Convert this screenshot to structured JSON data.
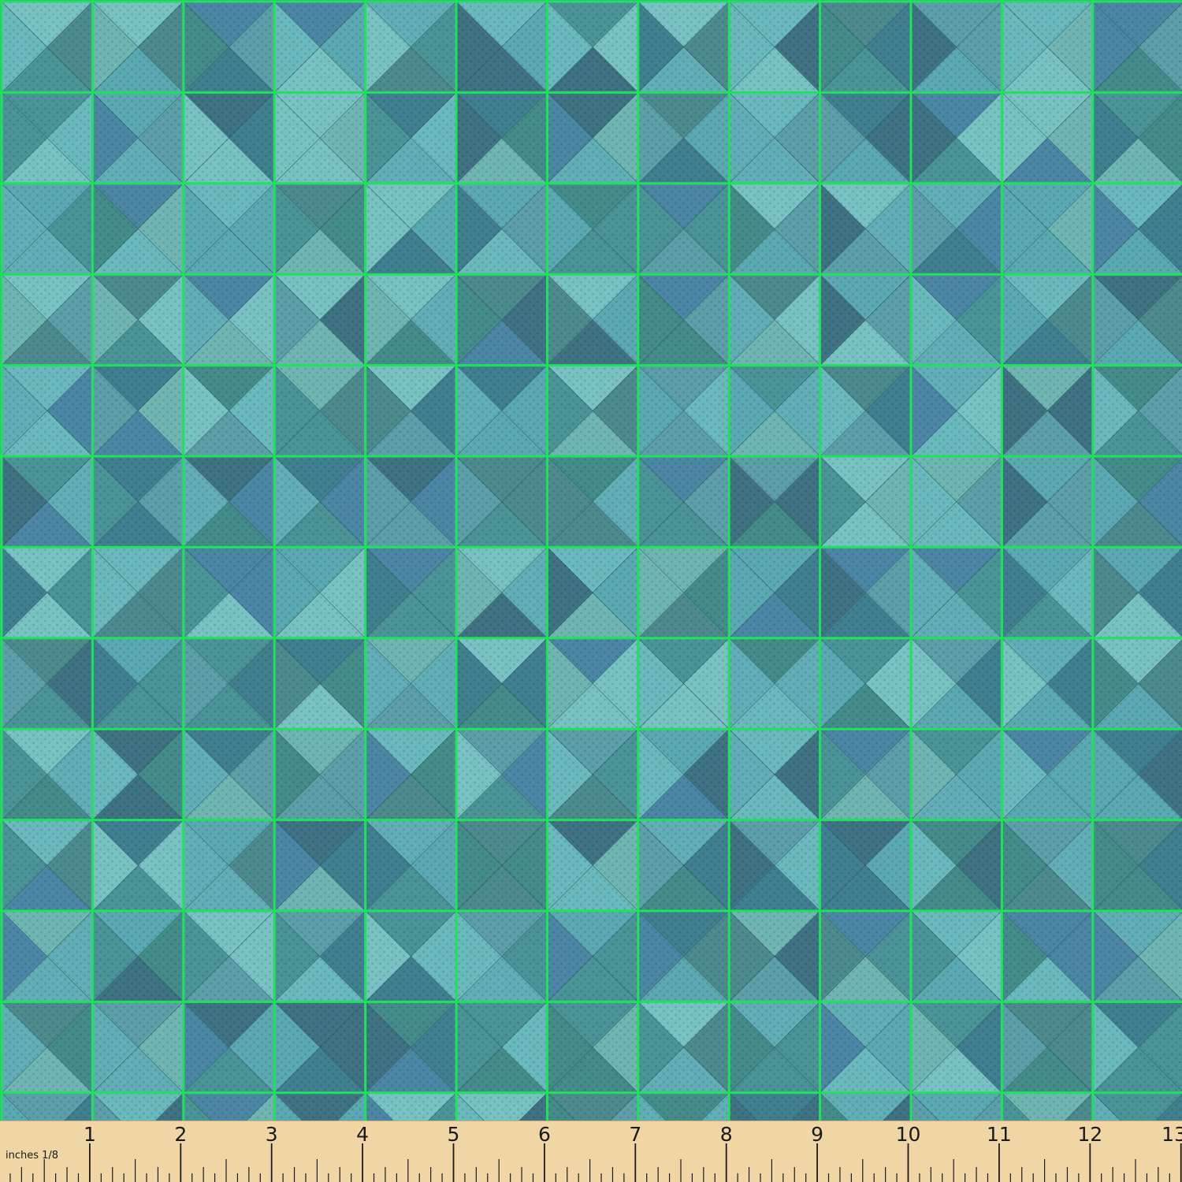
{
  "image": {
    "subject": "teal and blue geometric triangle fabric print with green grid overlay",
    "colors": {
      "base": "#4f9aa0",
      "palette": [
        "#5aa8b1",
        "#4a9497",
        "#6ab9bd",
        "#3f7f90",
        "#5c9fa8",
        "#78c2c3",
        "#4d8a8e",
        "#4c86a5",
        "#62aeb7",
        "#448c8a",
        "#6fb6b2",
        "#3f7282"
      ],
      "grid_line": "#1ee35a",
      "triangle_edge": "#2f5f66",
      "ruler_bg": "#f0d6a4",
      "ruler_ink": "#1a1a1a"
    }
  },
  "ruler": {
    "units_label": "inches 1/8",
    "numbers": [
      "1",
      "2",
      "3",
      "4",
      "5",
      "6",
      "7",
      "8",
      "9",
      "10",
      "11",
      "12",
      "13"
    ]
  }
}
